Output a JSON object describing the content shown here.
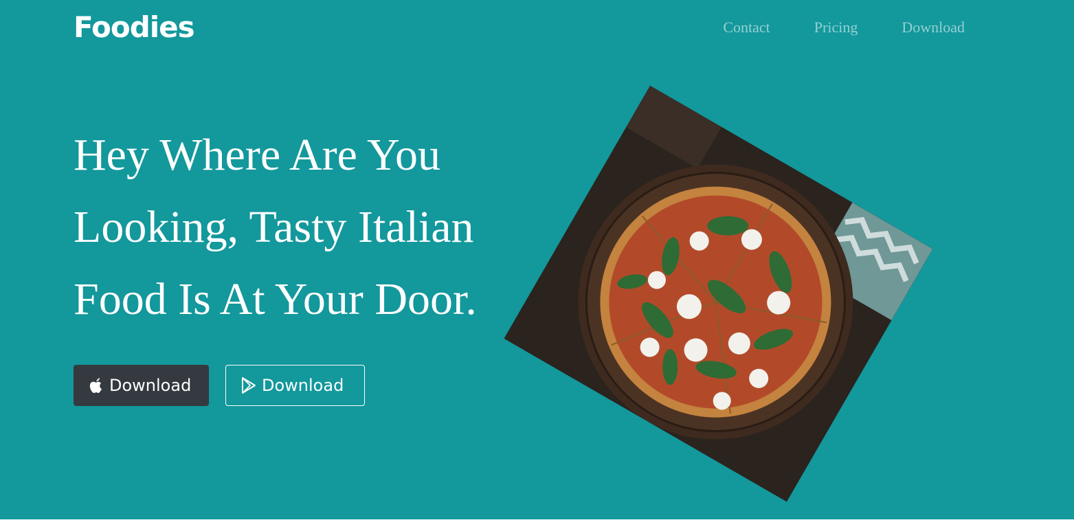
{
  "brand": {
    "name": "Foodies"
  },
  "nav": {
    "items": [
      {
        "label": "Contact"
      },
      {
        "label": "Pricing"
      },
      {
        "label": "Download"
      }
    ]
  },
  "hero": {
    "headline_lines": [
      "Hey Where Are You",
      "Looking, Tasty Italian",
      "Food Is At Your Door."
    ],
    "buttons": {
      "apple": {
        "label": "Download",
        "icon": "apple-icon"
      },
      "play": {
        "label": "Download",
        "icon": "play-store-icon"
      }
    },
    "image": {
      "subject": "pizza-photo"
    }
  },
  "colors": {
    "hero_background": "#13989c",
    "dark_button": "#343a40",
    "text": "#ffffff"
  }
}
